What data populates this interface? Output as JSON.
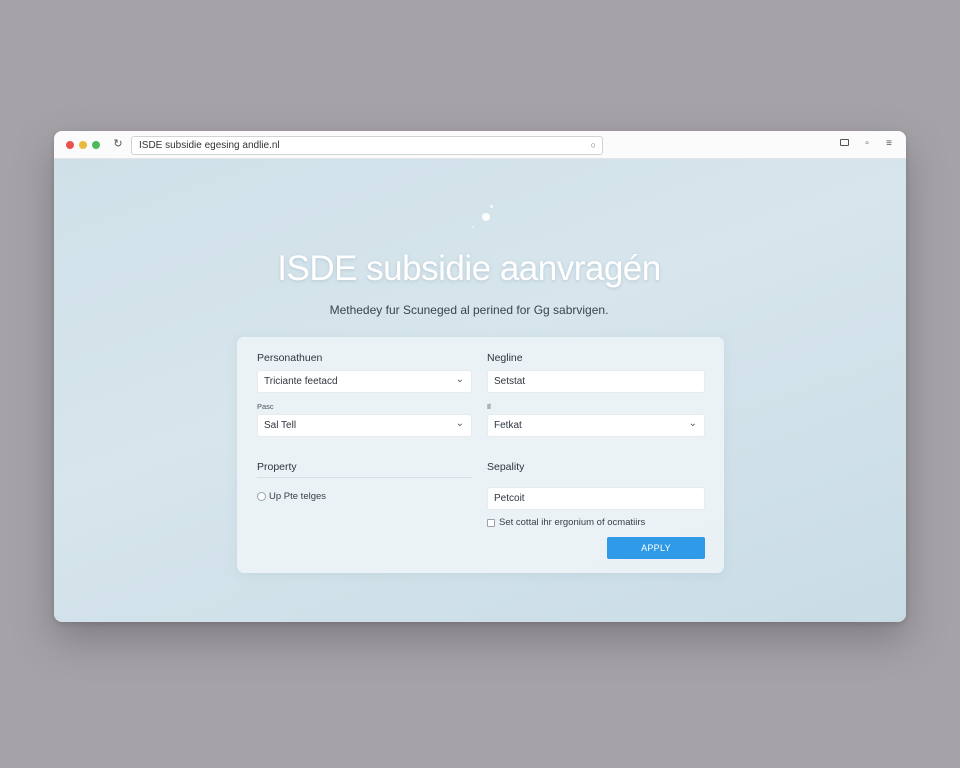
{
  "browser": {
    "url": "ISDE subsidie egesing andlie.nl"
  },
  "hero": {
    "title": "ISDE subsidie aanvragén",
    "subtitle": "Methedey fur Scuneged al perined for Gg sabrvigen."
  },
  "form": {
    "left_section_label": "Personathuen",
    "left_select_value": "Triciante feetacd",
    "left_small_label": "Pasc",
    "left_select2_value": "Sal Tell",
    "property_label": "Property",
    "radio_option": "Up Pte telges",
    "right_section_label": "Negline",
    "right_input_value": "Setstat",
    "right_small_label": "Il",
    "right_select_value": "Fetkat",
    "capacity_label": "Sepality",
    "right_input2_value": "Petcoit",
    "checkbox_label": "Set cottal ihr ergonium of ocmatiirs",
    "apply_button": "APPLY"
  },
  "colors": {
    "accent": "#2f9ae8",
    "window_bg": "#cfe0e8",
    "desktop_bg": "#a6a3a8"
  },
  "icons": [
    "reload-icon",
    "lock-icon",
    "window-icon",
    "share-icon",
    "menu-icon",
    "chevron-down-icon"
  ]
}
